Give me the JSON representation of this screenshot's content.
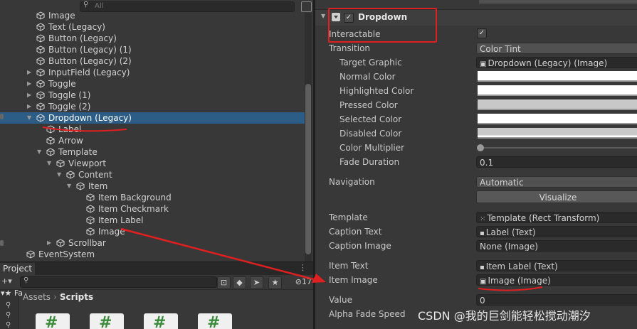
{
  "hierarchy": {
    "search_placeholder": "All",
    "items": [
      {
        "label": "Image",
        "depth": 0,
        "expand": "none"
      },
      {
        "label": "Text (Legacy)",
        "depth": 0,
        "expand": "none"
      },
      {
        "label": "Button (Legacy)",
        "depth": 0,
        "expand": "none"
      },
      {
        "label": "Button (Legacy) (1)",
        "depth": 0,
        "expand": "none"
      },
      {
        "label": "Button (Legacy) (2)",
        "depth": 0,
        "expand": "none"
      },
      {
        "label": "InputField (Legacy)",
        "depth": 0,
        "expand": "collapsed"
      },
      {
        "label": "Toggle",
        "depth": 0,
        "expand": "collapsed"
      },
      {
        "label": "Toggle (1)",
        "depth": 0,
        "expand": "collapsed"
      },
      {
        "label": "Toggle (2)",
        "depth": 0,
        "expand": "collapsed"
      },
      {
        "label": "Dropdown (Legacy)",
        "depth": 0,
        "expand": "expanded",
        "selected": true
      },
      {
        "label": "Label",
        "depth": 1,
        "expand": "none"
      },
      {
        "label": "Arrow",
        "depth": 1,
        "expand": "none"
      },
      {
        "label": "Template",
        "depth": 1,
        "expand": "expanded"
      },
      {
        "label": "Viewport",
        "depth": 2,
        "expand": "expanded"
      },
      {
        "label": "Content",
        "depth": 3,
        "expand": "expanded"
      },
      {
        "label": "Item",
        "depth": 4,
        "expand": "expanded"
      },
      {
        "label": "Item Background",
        "depth": 5,
        "expand": "none"
      },
      {
        "label": "Item Checkmark",
        "depth": 5,
        "expand": "none"
      },
      {
        "label": "Item Label",
        "depth": 5,
        "expand": "none"
      },
      {
        "label": "Image",
        "depth": 5,
        "expand": "none"
      },
      {
        "label": "Scrollbar",
        "depth": 2,
        "expand": "collapsed"
      },
      {
        "label": "EventSystem",
        "depth": -1,
        "expand": "none"
      }
    ]
  },
  "project": {
    "tab_label": "Project",
    "hidden_count": "17",
    "side_label": "Fa",
    "breadcrumb": {
      "root": "Assets",
      "separator": "›",
      "current": "Scripts"
    },
    "file_glyph": "#"
  },
  "inspector": {
    "component_title": "Dropdown",
    "component_enabled": true,
    "properties": {
      "interactable": {
        "label": "Interactable",
        "checked": true
      },
      "transition": {
        "label": "Transition",
        "value": "Color Tint"
      },
      "target_graphic": {
        "label": "Target Graphic",
        "value": "Dropdown (Legacy) (Image)"
      },
      "normal_color": {
        "label": "Normal Color",
        "swatch": "#ffffff"
      },
      "highlighted_color": {
        "label": "Highlighted Color",
        "swatch": "#f5f5f5"
      },
      "pressed_color": {
        "label": "Pressed Color",
        "swatch": "#c8c8c8"
      },
      "selected_color": {
        "label": "Selected Color",
        "swatch": "#f5f5f5"
      },
      "disabled_color": {
        "label": "Disabled Color",
        "swatch": "#c8c8c8"
      },
      "color_multiplier": {
        "label": "Color Multiplier",
        "value": 1
      },
      "fade_duration": {
        "label": "Fade Duration",
        "value": "0.1"
      },
      "navigation": {
        "label": "Navigation",
        "value": "Automatic"
      },
      "visualize_label": "Visualize",
      "template": {
        "label": "Template",
        "value": "Template (Rect Transform)"
      },
      "caption_text": {
        "label": "Caption Text",
        "value": "Label (Text)"
      },
      "caption_image": {
        "label": "Caption Image",
        "value": "None (Image)"
      },
      "item_text": {
        "label": "Item Text",
        "value": "Item Label (Text)"
      },
      "item_image": {
        "label": "Item Image",
        "value": "Image (Image)"
      },
      "value": {
        "label": "Value",
        "value": "0"
      },
      "alpha_fade_speed": {
        "label": "Alpha Fade Speed",
        "value": ""
      }
    }
  },
  "watermark": "CSDN @我的巨剑能轻松搅动潮汐",
  "colors": {
    "selection": "#2c5d87",
    "annotation_red": "#e02020",
    "panel_bg": "#383838"
  }
}
